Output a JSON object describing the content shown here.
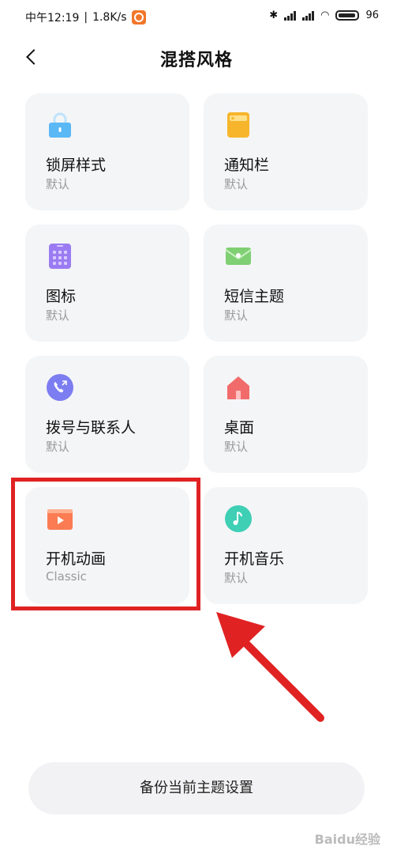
{
  "status": {
    "time": "中午12:19",
    "speed": "1.8K/s",
    "battery": "96"
  },
  "header": {
    "title": "混搭风格"
  },
  "cards": [
    {
      "label": "锁屏样式",
      "sub": "默认",
      "icon": "lock-icon",
      "color": "#5ab8f5"
    },
    {
      "label": "通知栏",
      "sub": "默认",
      "icon": "notification-icon",
      "color": "#f7b52c"
    },
    {
      "label": "图标",
      "sub": "默认",
      "icon": "grid-icon",
      "color": "#9b7bf2"
    },
    {
      "label": "短信主题",
      "sub": "默认",
      "icon": "message-icon",
      "color": "#7fcf73"
    },
    {
      "label": "拨号与联系人",
      "sub": "默认",
      "icon": "phone-icon",
      "color": "#7b7df0"
    },
    {
      "label": "桌面",
      "sub": "默认",
      "icon": "home-icon",
      "color": "#f26b6b"
    },
    {
      "label": "开机动画",
      "sub": "Classic",
      "icon": "video-icon",
      "color": "#fb7c52"
    },
    {
      "label": "开机音乐",
      "sub": "默认",
      "icon": "music-icon",
      "color": "#3ecfb5"
    }
  ],
  "backup_button": "备份当前主题设置",
  "watermark": "Baidu经验"
}
